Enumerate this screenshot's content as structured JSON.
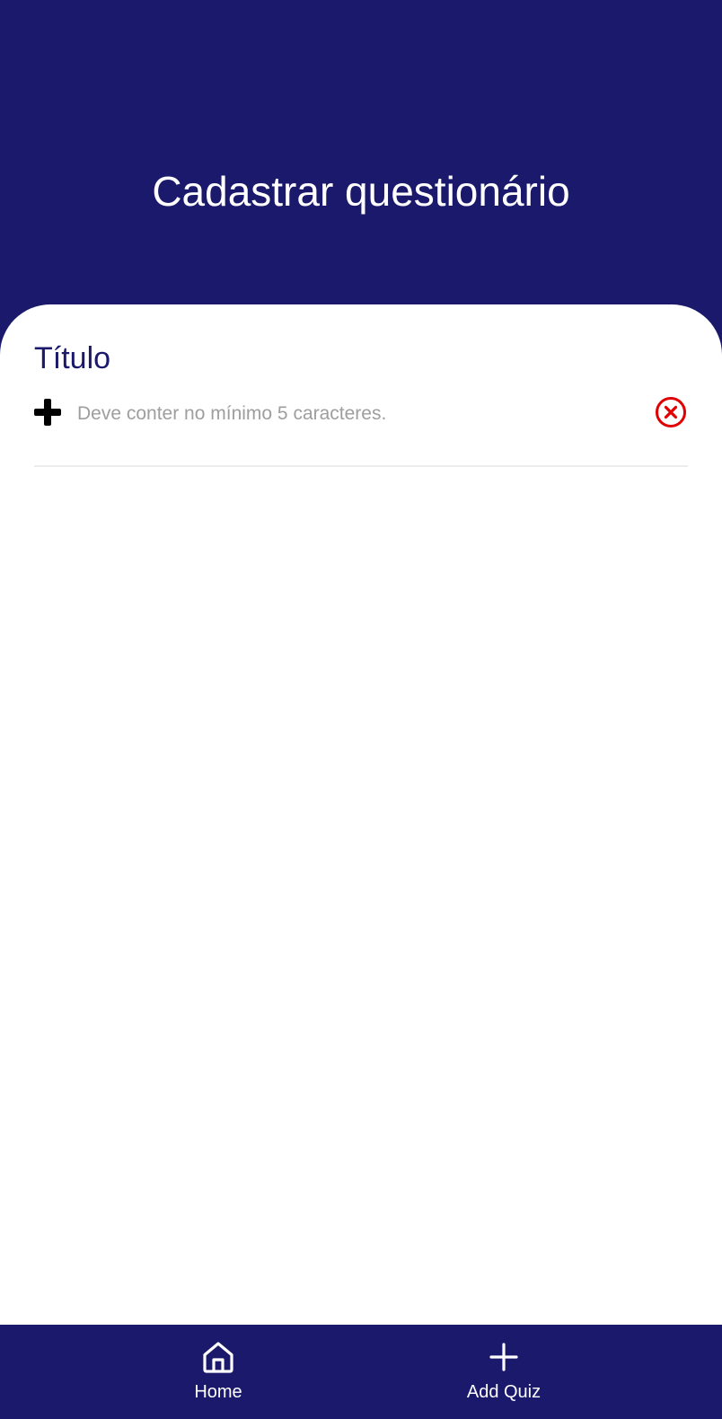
{
  "header": {
    "title": "Cadastrar questionário"
  },
  "form": {
    "title_field": {
      "label": "Título",
      "value": "",
      "placeholder": "Deve conter no mínimo 5 caracteres.",
      "leading_icon": "plus-icon",
      "trailing_icon": "clear-circle-icon"
    }
  },
  "bottom_nav": {
    "items": [
      {
        "label": "Home",
        "icon": "home-icon"
      },
      {
        "label": "Add Quiz",
        "icon": "plus-icon"
      }
    ]
  },
  "colors": {
    "primary": "#1a196c",
    "error": "#e00000",
    "placeholder": "#9e9e9e",
    "background": "#ffffff"
  }
}
